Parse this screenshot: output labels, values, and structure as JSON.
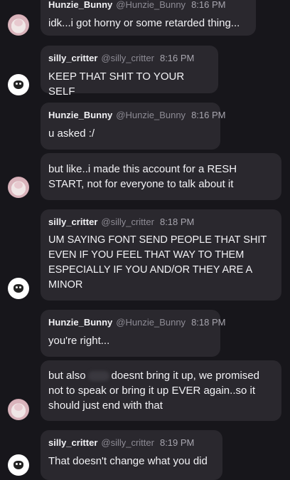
{
  "messages": [
    {
      "user": "Hunzie_Bunny",
      "handle": "@Hunzie_Bunny",
      "time": "8:16 PM",
      "text": "idk...i got horny or some retarded thing...",
      "avatar": "bunny-avatar"
    },
    {
      "user": "silly_critter",
      "handle": "@silly_critter",
      "time": "8:16 PM",
      "text": "KEEP THAT SHIT TO YOUR SELF",
      "avatar": "critter-avatar"
    },
    {
      "user": "Hunzie_Bunny",
      "handle": "@Hunzie_Bunny",
      "time": "8:16 PM",
      "text": "u asked :/",
      "avatar": "bunny-avatar"
    },
    {
      "user": "",
      "handle": "",
      "time": "",
      "text": "but like..i made this account for a RESH START, not for everyone to talk about it",
      "avatar": "bunny-avatar"
    },
    {
      "user": "silly_critter",
      "handle": "@silly_critter",
      "time": "8:18 PM",
      "text": "UM SAYING FONT SEND PEOPLE THAT SHIT EVEN IF YOU FEEL THAT WAY TO THEM ESPECIALLY IF YOU AND/OR THEY ARE A MINOR",
      "avatar": "critter-avatar"
    },
    {
      "user": "Hunzie_Bunny",
      "handle": "@Hunzie_Bunny",
      "time": "8:18 PM",
      "text": "you're right...",
      "avatar": "bunny-avatar"
    },
    {
      "user": "",
      "handle": "",
      "time": "",
      "text_before": "but also",
      "text_after": "doesnt bring it up, we promised not to speak or bring it up EVER again..so it should just end with that",
      "avatar": "bunny-avatar"
    },
    {
      "user": "silly_critter",
      "handle": "@silly_critter",
      "time": "8:19 PM",
      "text": "That doesn't change what you did",
      "avatar": "critter-avatar"
    }
  ]
}
